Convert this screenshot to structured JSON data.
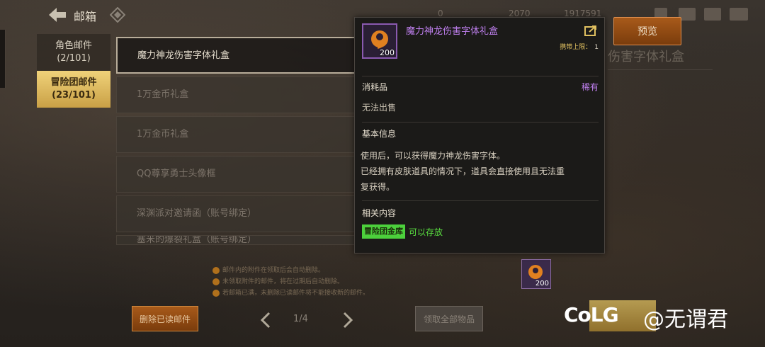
{
  "header": {
    "title": "邮箱",
    "currencies": [
      "0",
      "2070",
      "1917591"
    ]
  },
  "sidebar": {
    "tabs": [
      {
        "label": "角色邮件",
        "count": "(2/101)"
      },
      {
        "label": "冒险团邮件",
        "count": "(23/101)"
      }
    ]
  },
  "mail_list": {
    "items": [
      {
        "title": "魔力神龙伤害字体礼盒"
      },
      {
        "title": "1万金币礼盒"
      },
      {
        "title": "1万金币礼盒"
      },
      {
        "title": "QQ尊享勇士头像框"
      },
      {
        "title": "深渊派对邀请函（账号绑定）"
      },
      {
        "title": "塞米的爆裂礼盒（账号绑定）"
      }
    ]
  },
  "notes": [
    "邮件内的附件在领取后会自动删除。",
    "未领取附件的邮件，将在过期后自动删除。",
    "若邮箱已满，未删除已读邮件将不能接收新的邮件。"
  ],
  "footer": {
    "delete_label": "删除已读邮件",
    "collect_label": "领取全部物品",
    "page": "1/4"
  },
  "right_panel": {
    "title": "伤害字体礼盒",
    "preview_label": "预览",
    "item_count": "200"
  },
  "tooltip": {
    "item_name": "魔力神龙伤害字体礼盒",
    "item_count": "200",
    "limit_label": "携带上限：",
    "limit_value": "1",
    "type": "消耗品",
    "rarity": "稀有",
    "trade": "无法出售",
    "basic_heading": "基本信息",
    "desc_line1": "使用后，可以获得魔力神龙伤害字体。",
    "desc_line2": "已经拥有皮肤道具的情况下，道具会直接使用且无法重",
    "desc_line3": "复获得。",
    "related_heading": "相关内容",
    "storage_badge": "冒险团金库",
    "storable": "可以存放"
  },
  "watermark": {
    "logo": "CoLG",
    "text": "@无谓君"
  },
  "colors": {
    "rare_purple": "#c080f0",
    "storable_green": "#5ae040",
    "accent_gold": "#e0c060",
    "button_orange": "#a85a1a"
  }
}
